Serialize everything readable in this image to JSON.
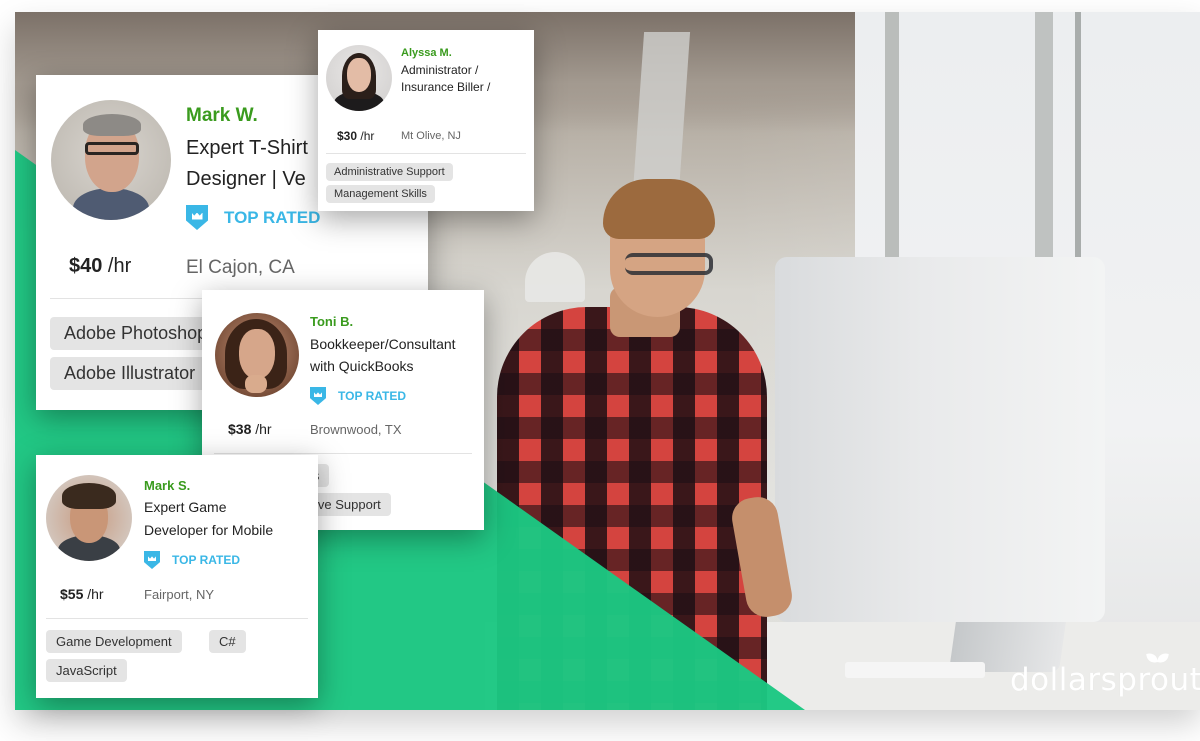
{
  "brand": {
    "logo_text": "dollarsprout",
    "accent_green": "#1cc782",
    "name_green": "#3a9b1e",
    "top_rated_blue": "#3ab7e6"
  },
  "cards": [
    {
      "id": "mark-w",
      "name": "Mark W.",
      "title_line1": "Expert T-Shirt",
      "title_line2": "Designer | Ve",
      "top_rated": true,
      "badge_label": "TOP RATED",
      "rate_amount": "$40",
      "rate_unit": " /hr",
      "location": "El Cajon, CA",
      "skills": [
        "Adobe Photoshop",
        "Adobe Illustrator"
      ]
    },
    {
      "id": "alyssa-m",
      "name": "Alyssa M.",
      "title_line1": "Administrator /",
      "title_line2": "Insurance Biller /",
      "top_rated": false,
      "rate_amount": "$30",
      "rate_unit": " /hr",
      "location": "Mt Olive, NJ",
      "skills": [
        "Administrative Support",
        "Management Skills"
      ]
    },
    {
      "id": "toni-b",
      "name": "Toni B.",
      "title_line1": "Bookkeeper/Consultant",
      "title_line2": "with QuickBooks",
      "top_rated": true,
      "badge_label": "TOP RATED",
      "rate_amount": "$38",
      "rate_unit": " /hr",
      "location": "Brownwood, TX",
      "skills": [
        "QuickBooks",
        "Administrative Support"
      ]
    },
    {
      "id": "mark-s",
      "name": "Mark S.",
      "title_line1": "Expert Game",
      "title_line2": "Developer for Mobile",
      "top_rated": true,
      "badge_label": "TOP RATED",
      "rate_amount": "$55",
      "rate_unit": " /hr",
      "location": "Fairport, NY",
      "skills": [
        "Game Development",
        "C#",
        "JavaScript"
      ]
    }
  ]
}
